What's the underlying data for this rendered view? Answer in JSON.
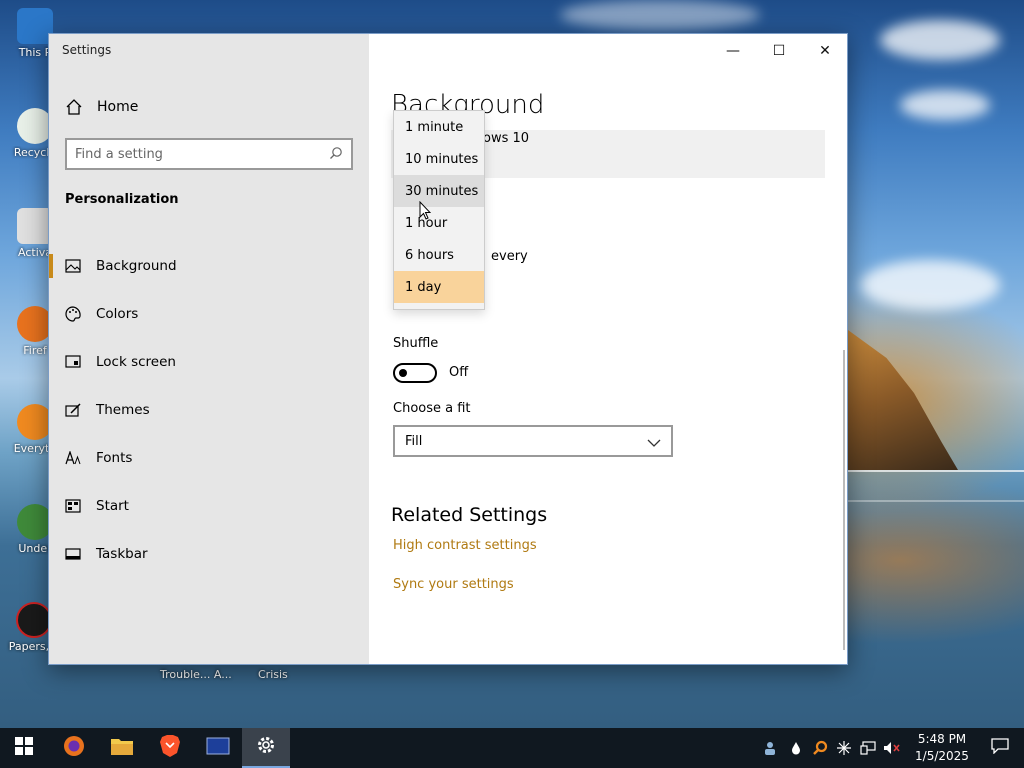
{
  "desktop": {
    "icons": [
      {
        "label": "This P",
        "color": "#2b77c8"
      },
      {
        "label": "Recycle",
        "color": "#3ea36a"
      },
      {
        "label": "Activa",
        "color": "#d8d8d8"
      },
      {
        "label": "Firef",
        "color": "#e8721e"
      },
      {
        "label": "Everyth",
        "color": "#f08a20"
      },
      {
        "label": "Under",
        "color": "#3f8a3a"
      },
      {
        "label": "Papers, P",
        "color": "#1a1a1a"
      }
    ],
    "bottom_labels": [
      "Trouble... A...",
      "Crisis"
    ]
  },
  "window": {
    "title": "Settings",
    "controls": {
      "minimize": "—",
      "maximize": "☐",
      "close": "✕"
    }
  },
  "sidebar": {
    "home_label": "Home",
    "search_placeholder": "Find a setting",
    "section_title": "Personalization",
    "items": [
      {
        "label": "Background",
        "icon": "picture-icon",
        "active": true
      },
      {
        "label": "Colors",
        "icon": "palette-icon"
      },
      {
        "label": "Lock screen",
        "icon": "lock-screen-icon"
      },
      {
        "label": "Themes",
        "icon": "brush-icon"
      },
      {
        "label": "Fonts",
        "icon": "fonts-icon"
      },
      {
        "label": "Start",
        "icon": "start-grid-icon"
      },
      {
        "label": "Taskbar",
        "icon": "taskbar-icon"
      }
    ]
  },
  "main": {
    "title": "Background",
    "preview_text": "ows 10",
    "change_picture_partial": "every",
    "shuffle_label": "Shuffle",
    "shuffle_state": "Off",
    "fit_label": "Choose a fit",
    "fit_value": "Fill",
    "related_title": "Related Settings",
    "links": [
      "High contrast settings",
      "Sync your settings"
    ]
  },
  "interval_dropdown": {
    "options": [
      "1 minute",
      "10 minutes",
      "30 minutes",
      "1 hour",
      "6 hours",
      "1 day"
    ],
    "hovered": "30 minutes",
    "selected": "1 day"
  },
  "taskbar": {
    "apps": [
      "firefox-icon",
      "file-explorer-icon",
      "brave-icon",
      "monitor-app-icon",
      "settings-gear-icon"
    ],
    "active_app": "settings-gear-icon",
    "clock_time": "5:48 PM",
    "clock_date": "1/5/2025"
  },
  "colors": {
    "accent": "#c88a1a",
    "link": "#b07a12",
    "dropdown_selected": "#f9d39b",
    "sidebar_bg": "#e6e6e6",
    "taskbar_bg": "#101820"
  }
}
